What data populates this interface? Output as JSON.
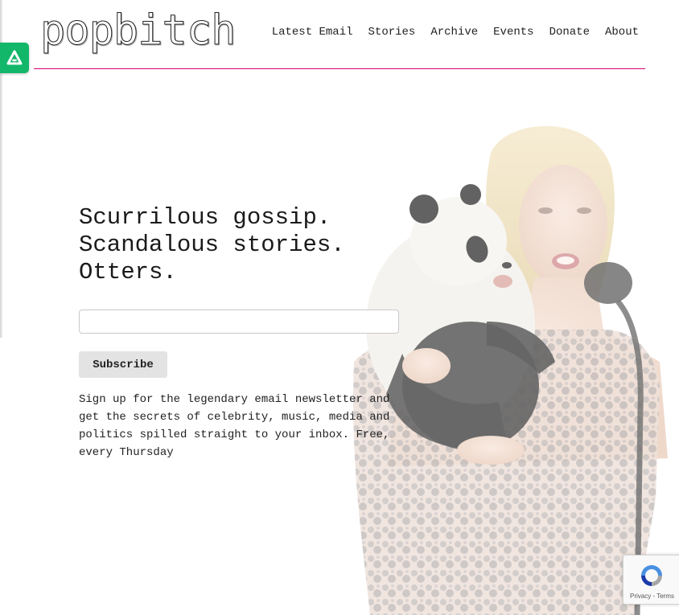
{
  "brand": {
    "logo_text": "popbitch"
  },
  "nav": {
    "items": [
      "Latest Email",
      "Stories",
      "Archive",
      "Events",
      "Donate",
      "About"
    ]
  },
  "hero": {
    "headline_lines": [
      "Scurrilous gossip.",
      "Scandalous stories.",
      "Otters."
    ]
  },
  "signup": {
    "email_value": "",
    "email_placeholder": "",
    "subscribe_label": "Subscribe",
    "description": "Sign up for the legendary email newsletter and get the secrets of celebrity, music, media and politics spilled straight to your inbox. Free, every Thursday"
  },
  "recaptcha": {
    "terms_text": "Privacy - Terms",
    "icon": "recaptcha-icon"
  },
  "side_badge": {
    "icon": "triangle-a-icon",
    "color": "#12b76a"
  },
  "colors": {
    "accent_rule": "#d6006f"
  }
}
